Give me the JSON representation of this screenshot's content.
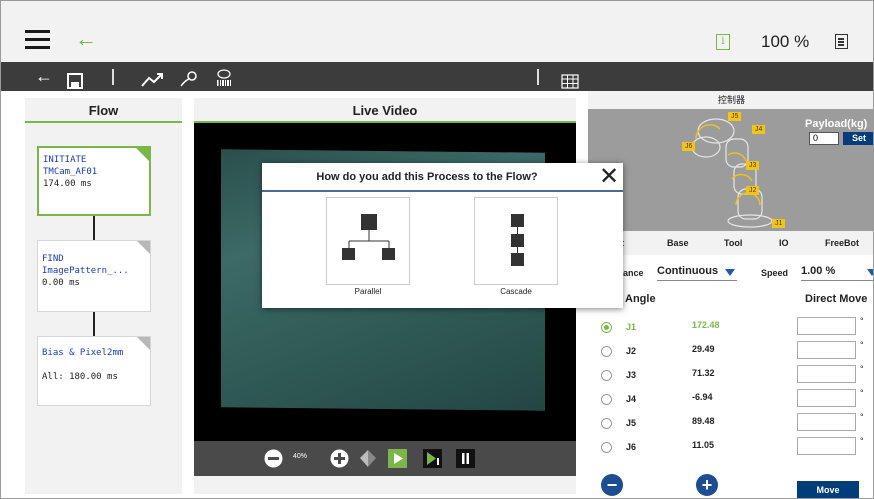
{
  "topbar": {
    "zoom": "100 %"
  },
  "flow_panel": {
    "title": "Flow",
    "nodes": [
      {
        "line1": "INITIATE",
        "line2": "TMCam_AF01",
        "line3": "174.00 ms"
      },
      {
        "line1": "FIND",
        "line2": "ImagePattern_...",
        "line3": "0.00 ms"
      },
      {
        "line1": "Bias & Pixel2mm",
        "line2": "",
        "line3": "All: 180.00 ms"
      }
    ]
  },
  "video_panel": {
    "title": "Live Video",
    "zoom": "40%"
  },
  "controller": {
    "header": "控制器",
    "payload_label": "Payload(kg)",
    "payload_value": "0",
    "set_label": "Set",
    "joint_tags": [
      "J1",
      "J2",
      "J3",
      "J4",
      "J5",
      "J6"
    ],
    "tabs": [
      "t",
      "Base",
      "Tool",
      "IO",
      "FreeBot"
    ],
    "mode_label": "ance",
    "mode_value": "Continuous",
    "speed_label": "Speed",
    "speed_value": "1.00 %",
    "angle_label": "Angle",
    "direct_move_label": "Direct Move",
    "joints": [
      {
        "name": "J1",
        "value": "172.48",
        "selected": true
      },
      {
        "name": "J2",
        "value": "29.49",
        "selected": false
      },
      {
        "name": "J3",
        "value": "71.32",
        "selected": false
      },
      {
        "name": "J4",
        "value": "-6.94",
        "selected": false
      },
      {
        "name": "J5",
        "value": "89.48",
        "selected": false
      },
      {
        "name": "J6",
        "value": "11.05",
        "selected": false
      }
    ],
    "move_label": "Move"
  },
  "modal": {
    "title": "How do you add this Process to the Flow?",
    "options": [
      {
        "label": "Parallel"
      },
      {
        "label": "Cascade"
      }
    ]
  },
  "colors": {
    "accent_green": "#7ab648",
    "toolbar": "#3c3c3c",
    "primary_blue": "#003d7a",
    "robot_tag": "#f0c419"
  }
}
